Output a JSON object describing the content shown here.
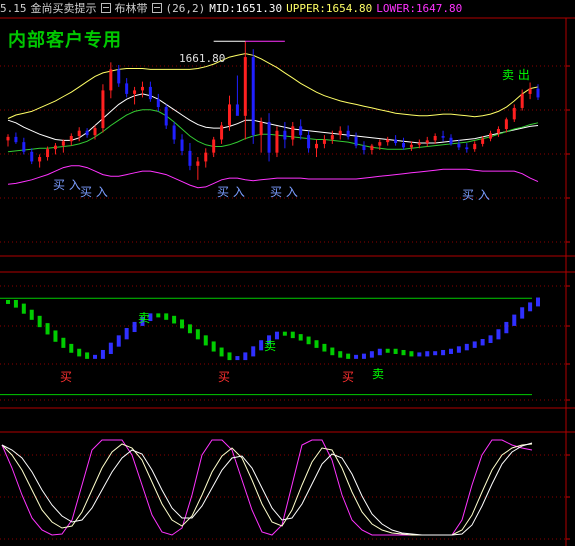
{
  "header": {
    "prefix": "5.15",
    "indicator_title": "金尚买卖提示",
    "band_name": "布林带",
    "params": "(26,2)",
    "mid_label": "MID:1651.30",
    "upper_label": "UPPER:1654.80",
    "lower_label": "LOWER:1647.80",
    "colors": {
      "title": "#d0d0d0",
      "mid": "#ffffff",
      "upper": "#ffff66",
      "lower": "#ff33ff"
    }
  },
  "watermark": "内部客户专用",
  "annotations": {
    "peak_price": "1661.80",
    "sell_top": "卖 出",
    "buy_labels": [
      "买 入",
      "买 入",
      "买 入",
      "买 入",
      "买 入"
    ],
    "osc_sell": "卖",
    "osc_buy": "买"
  },
  "colors": {
    "up_candle": "#ff2020",
    "down_candle": "#2020ff",
    "neutral": "#ff33ff",
    "grid": "#8b0000",
    "panel_border": "#b00000",
    "buy_text": "#7b9dff",
    "sell_text": "#00ff00",
    "osc_up": "#3030ff",
    "osc_down": "#00cc00"
  },
  "chart_data": [
    {
      "type": "candlestick",
      "panel": "price",
      "ylim": [
        1638,
        1664
      ],
      "candles": [
        [
          1650.5,
          1651.2,
          1649.8,
          1650.9
        ],
        [
          1650.9,
          1651.4,
          1650.1,
          1650.3
        ],
        [
          1650.3,
          1650.8,
          1648.9,
          1649.2
        ],
        [
          1649.2,
          1649.6,
          1647.8,
          1648.1
        ],
        [
          1648.1,
          1648.9,
          1647.4,
          1648.6
        ],
        [
          1648.6,
          1649.8,
          1648.2,
          1649.5
        ],
        [
          1649.5,
          1650.2,
          1648.9,
          1649.9
        ],
        [
          1649.9,
          1650.6,
          1649.1,
          1650.4
        ],
        [
          1650.4,
          1651.3,
          1649.9,
          1651.0
        ],
        [
          1651.0,
          1652.0,
          1650.4,
          1651.6
        ],
        [
          1651.6,
          1651.9,
          1650.8,
          1651.1
        ],
        [
          1651.1,
          1652.2,
          1650.6,
          1651.9
        ],
        [
          1651.9,
          1656.9,
          1651.4,
          1656.2
        ],
        [
          1656.2,
          1659.4,
          1655.3,
          1658.6
        ],
        [
          1658.6,
          1659.1,
          1656.6,
          1657.0
        ],
        [
          1657.0,
          1657.6,
          1655.4,
          1655.8
        ],
        [
          1655.8,
          1656.6,
          1654.6,
          1656.2
        ],
        [
          1656.2,
          1657.2,
          1655.4,
          1656.6
        ],
        [
          1656.6,
          1657.2,
          1654.9,
          1655.2
        ],
        [
          1655.2,
          1655.8,
          1653.8,
          1654.3
        ],
        [
          1654.3,
          1654.6,
          1651.8,
          1652.2
        ],
        [
          1652.2,
          1652.6,
          1650.1,
          1650.6
        ],
        [
          1650.6,
          1651.2,
          1648.8,
          1649.3
        ],
        [
          1649.3,
          1650.2,
          1647.1,
          1647.6
        ],
        [
          1647.6,
          1648.6,
          1646.0,
          1648.1
        ],
        [
          1648.1,
          1649.6,
          1647.4,
          1649.1
        ],
        [
          1649.1,
          1650.9,
          1648.6,
          1650.6
        ],
        [
          1650.6,
          1652.6,
          1650.1,
          1652.2
        ],
        [
          1652.2,
          1655.6,
          1651.6,
          1654.6
        ],
        [
          1654.6,
          1657.9,
          1653.9,
          1653.3
        ],
        [
          1653.3,
          1661.8,
          1650.6,
          1660.0
        ],
        [
          1660.0,
          1660.9,
          1650.1,
          1651.1
        ],
        [
          1651.1,
          1653.1,
          1649.1,
          1652.6
        ],
        [
          1652.6,
          1653.6,
          1648.1,
          1649.1
        ],
        [
          1649.1,
          1652.1,
          1648.6,
          1651.6
        ],
        [
          1651.6,
          1652.6,
          1649.6,
          1650.6
        ],
        [
          1650.6,
          1652.6,
          1649.9,
          1652.1
        ],
        [
          1652.1,
          1652.9,
          1650.6,
          1651.1
        ],
        [
          1651.1,
          1651.6,
          1649.1,
          1649.6
        ],
        [
          1649.6,
          1650.6,
          1648.6,
          1650.1
        ],
        [
          1650.1,
          1651.1,
          1649.6,
          1650.6
        ],
        [
          1650.6,
          1651.6,
          1650.1,
          1651.1
        ],
        [
          1651.1,
          1652.1,
          1650.6,
          1651.6
        ],
        [
          1651.6,
          1652.2,
          1650.6,
          1650.9
        ],
        [
          1650.9,
          1651.4,
          1649.6,
          1649.9
        ],
        [
          1649.9,
          1650.4,
          1648.9,
          1649.4
        ],
        [
          1649.4,
          1650.1,
          1648.9,
          1649.9
        ],
        [
          1649.9,
          1650.6,
          1649.4,
          1650.3
        ],
        [
          1650.3,
          1650.9,
          1649.9,
          1650.6
        ],
        [
          1650.6,
          1651.1,
          1649.9,
          1650.2
        ],
        [
          1650.2,
          1650.8,
          1649.4,
          1649.7
        ],
        [
          1649.7,
          1650.4,
          1649.3,
          1650.0
        ],
        [
          1650.0,
          1650.6,
          1649.6,
          1650.2
        ],
        [
          1650.2,
          1650.9,
          1649.8,
          1650.5
        ],
        [
          1650.5,
          1651.3,
          1650.1,
          1651.0
        ],
        [
          1651.0,
          1651.6,
          1650.4,
          1650.8
        ],
        [
          1650.8,
          1651.2,
          1649.9,
          1650.1
        ],
        [
          1650.1,
          1650.6,
          1649.4,
          1649.7
        ],
        [
          1649.7,
          1650.2,
          1649.1,
          1649.5
        ],
        [
          1649.5,
          1650.4,
          1649.2,
          1650.1
        ],
        [
          1650.1,
          1651.0,
          1649.8,
          1650.7
        ],
        [
          1650.7,
          1651.6,
          1650.4,
          1651.3
        ],
        [
          1651.3,
          1652.1,
          1650.9,
          1651.8
        ],
        [
          1651.8,
          1653.1,
          1651.4,
          1652.9
        ],
        [
          1652.9,
          1654.6,
          1652.6,
          1654.2
        ],
        [
          1654.2,
          1656.3,
          1653.9,
          1655.8
        ],
        [
          1655.8,
          1657.1,
          1655.2,
          1656.4
        ],
        [
          1656.4,
          1656.9,
          1655.1,
          1655.4
        ]
      ],
      "series": [
        {
          "name": "UPPER",
          "values": [
            1653,
            1653.4,
            1653.6,
            1653.8,
            1654.2,
            1654.6,
            1655.0,
            1655.5,
            1656.0,
            1656.6,
            1657.2,
            1657.8,
            1658.2,
            1658.4,
            1658.6,
            1658.7,
            1658.7,
            1658.7,
            1658.6,
            1658.6,
            1658.6,
            1658.6,
            1658.6,
            1658.6,
            1658.7,
            1658.9,
            1659.2,
            1659.6,
            1660.0,
            1660.2,
            1660.4,
            1660.2,
            1659.8,
            1659.3,
            1658.8,
            1658.2,
            1657.6,
            1657.0,
            1656.5,
            1656.0,
            1655.6,
            1655.3,
            1655.0,
            1654.8,
            1654.6,
            1654.4,
            1654.2,
            1654.0,
            1653.8,
            1653.6,
            1653.5,
            1653.4,
            1653.3,
            1653.3,
            1653.4,
            1653.5,
            1653.5,
            1653.4,
            1653.3,
            1653.2,
            1653.3,
            1653.5,
            1653.8,
            1654.3,
            1655.0,
            1655.8,
            1656.4,
            1656.6
          ]
        },
        {
          "name": "MID",
          "values": [
            1652.8,
            1652.5,
            1652.0,
            1651.6,
            1651.2,
            1650.9,
            1650.6,
            1650.5,
            1650.5,
            1650.8,
            1651.4,
            1652.2,
            1653.0,
            1653.8,
            1654.6,
            1655.2,
            1655.6,
            1655.8,
            1655.6,
            1655.2,
            1654.6,
            1654.0,
            1653.4,
            1652.8,
            1652.3,
            1652.0,
            1651.9,
            1651.9,
            1652.1,
            1652.4,
            1652.8,
            1652.8,
            1652.6,
            1652.4,
            1652.2,
            1652.0,
            1651.8,
            1651.7,
            1651.6,
            1651.5,
            1651.4,
            1651.3,
            1651.2,
            1651.1,
            1651.0,
            1650.9,
            1650.8,
            1650.7,
            1650.6,
            1650.5,
            1650.4,
            1650.3,
            1650.2,
            1650.2,
            1650.2,
            1650.3,
            1650.4,
            1650.5,
            1650.6,
            1650.7,
            1650.9,
            1651.1,
            1651.3,
            1651.5,
            1651.7,
            1651.9,
            1652.1,
            1652.2
          ]
        },
        {
          "name": "MA",
          "values": [
            1649.2,
            1649.3,
            1649.4,
            1649.5,
            1649.6,
            1649.6,
            1649.7,
            1649.8,
            1649.9,
            1650.1,
            1650.4,
            1650.9,
            1651.5,
            1652.2,
            1652.8,
            1653.4,
            1653.8,
            1654.0,
            1654.0,
            1653.8,
            1653.3,
            1652.6,
            1651.8,
            1651.0,
            1650.4,
            1650.0,
            1649.8,
            1649.8,
            1650.0,
            1650.3,
            1650.7,
            1651.0,
            1651.2,
            1651.2,
            1651.1,
            1651.0,
            1650.9,
            1650.8,
            1650.7,
            1650.6,
            1650.6,
            1650.5,
            1650.4,
            1650.3,
            1650.1,
            1649.9,
            1649.7,
            1649.6,
            1649.5,
            1649.5,
            1649.5,
            1649.6,
            1649.7,
            1649.8,
            1649.9,
            1650.0,
            1650.1,
            1650.2,
            1650.3,
            1650.5,
            1650.7,
            1650.9,
            1651.2,
            1651.5,
            1651.8,
            1652.0,
            1652.3,
            1652.5
          ]
        },
        {
          "name": "LOWER",
          "values": [
            1645.5,
            1645.6,
            1645.8,
            1646.0,
            1646.3,
            1646.6,
            1647.0,
            1647.4,
            1647.6,
            1647.6,
            1647.4,
            1647.0,
            1646.6,
            1646.4,
            1646.4,
            1646.6,
            1646.8,
            1647.0,
            1647.0,
            1646.8,
            1646.6,
            1646.2,
            1645.8,
            1645.4,
            1645.1,
            1645.2,
            1645.6,
            1646.0,
            1646.2,
            1646.2,
            1646.0,
            1645.9,
            1646.0,
            1646.1,
            1646.2,
            1646.2,
            1646.2,
            1646.2,
            1646.1,
            1646.1,
            1646.1,
            1646.1,
            1646.1,
            1646.1,
            1646.1,
            1646.2,
            1646.3,
            1646.4,
            1646.5,
            1646.6,
            1646.7,
            1646.8,
            1646.9,
            1647.0,
            1647.1,
            1647.2,
            1647.2,
            1647.2,
            1647.2,
            1647.1,
            1647.0,
            1647.0,
            1647.0,
            1647.0,
            1647.0,
            1646.7,
            1646.2,
            1645.8
          ]
        }
      ]
    },
    {
      "type": "bar",
      "panel": "oscillator",
      "ylim": [
        0,
        10
      ],
      "values": [
        8.2,
        7.9,
        7.4,
        6.9,
        6.3,
        5.7,
        5.1,
        4.6,
        4.2,
        3.9,
        3.7,
        3.7,
        4.1,
        4.7,
        5.3,
        5.9,
        6.4,
        6.8,
        7.1,
        7.1,
        6.9,
        6.6,
        6.2,
        5.8,
        5.3,
        4.8,
        4.3,
        3.9,
        3.6,
        3.6,
        3.9,
        4.4,
        4.9,
        5.3,
        5.6,
        5.6,
        5.4,
        5.2,
        4.9,
        4.6,
        4.3,
        4.0,
        3.8,
        3.7,
        3.7,
        3.8,
        4.0,
        4.2,
        4.2,
        4.1,
        4.0,
        3.9,
        3.9,
        4.0,
        4.0,
        4.1,
        4.2,
        4.4,
        4.6,
        4.8,
        5.0,
        5.3,
        5.8,
        6.4,
        7.0,
        7.6,
        8.0,
        8.4
      ],
      "direction": [
        "d",
        "d",
        "d",
        "d",
        "d",
        "d",
        "d",
        "d",
        "d",
        "d",
        "d",
        "u",
        "u",
        "u",
        "u",
        "u",
        "u",
        "u",
        "u",
        "d",
        "d",
        "d",
        "d",
        "d",
        "d",
        "d",
        "d",
        "d",
        "d",
        "u",
        "u",
        "u",
        "u",
        "u",
        "u",
        "d",
        "d",
        "d",
        "d",
        "d",
        "d",
        "d",
        "d",
        "d",
        "u",
        "u",
        "u",
        "u",
        "d",
        "d",
        "d",
        "d",
        "u",
        "u",
        "u",
        "u",
        "u",
        "u",
        "u",
        "u",
        "u",
        "u",
        "u",
        "u",
        "u",
        "u",
        "u",
        "u"
      ]
    },
    {
      "type": "line",
      "panel": "stochastic",
      "ylim": [
        0,
        1
      ],
      "series": [
        {
          "name": "K",
          "values": [
            0.95,
            0.72,
            0.45,
            0.22,
            0.1,
            0.05,
            0.06,
            0.2,
            0.55,
            0.9,
            1.0,
            1.0,
            1.0,
            0.85,
            0.55,
            0.25,
            0.08,
            0.05,
            0.12,
            0.45,
            0.85,
            1.0,
            1.0,
            0.9,
            0.6,
            0.3,
            0.08,
            0.05,
            0.15,
            0.55,
            0.95,
            1.0,
            1.0,
            0.8,
            0.45,
            0.2,
            0.1,
            0.05,
            0.05,
            0.05,
            0.05,
            0.05,
            0.05,
            0.05,
            0.05,
            0.05,
            0.2,
            0.55,
            0.85,
            1.0,
            1.0,
            0.95,
            0.92,
            0.9
          ]
        },
        {
          "name": "D",
          "values": [
            0.95,
            0.85,
            0.7,
            0.5,
            0.3,
            0.18,
            0.12,
            0.14,
            0.28,
            0.5,
            0.72,
            0.88,
            0.96,
            0.92,
            0.8,
            0.58,
            0.36,
            0.2,
            0.14,
            0.24,
            0.45,
            0.68,
            0.84,
            0.92,
            0.82,
            0.6,
            0.36,
            0.18,
            0.14,
            0.3,
            0.55,
            0.78,
            0.92,
            0.9,
            0.72,
            0.48,
            0.28,
            0.16,
            0.1,
            0.07,
            0.06,
            0.05,
            0.05,
            0.05,
            0.05,
            0.05,
            0.1,
            0.25,
            0.48,
            0.7,
            0.85,
            0.92,
            0.95,
            0.96
          ]
        },
        {
          "name": "J",
          "values": [
            0.95,
            0.9,
            0.82,
            0.68,
            0.5,
            0.35,
            0.24,
            0.18,
            0.2,
            0.32,
            0.5,
            0.68,
            0.82,
            0.9,
            0.86,
            0.7,
            0.5,
            0.32,
            0.22,
            0.22,
            0.34,
            0.52,
            0.7,
            0.82,
            0.84,
            0.72,
            0.52,
            0.32,
            0.2,
            0.22,
            0.36,
            0.56,
            0.76,
            0.86,
            0.82,
            0.66,
            0.44,
            0.26,
            0.16,
            0.1,
            0.07,
            0.06,
            0.05,
            0.05,
            0.05,
            0.05,
            0.06,
            0.15,
            0.34,
            0.56,
            0.76,
            0.88,
            0.94,
            0.97
          ]
        }
      ]
    }
  ]
}
